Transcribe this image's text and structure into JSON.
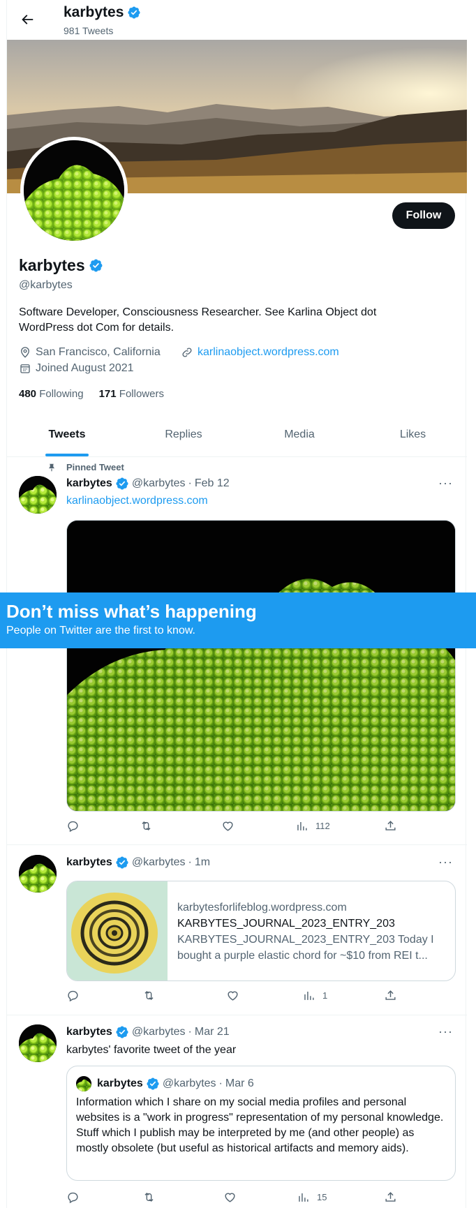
{
  "header": {
    "name": "karbytes",
    "tweet_count": "981 Tweets"
  },
  "profile": {
    "name": "karbytes",
    "handle": "@karbytes",
    "bio": "Software Developer, Consciousness Researcher. See Karlina Object dot WordPress dot Com for details.",
    "location": "San Francisco, California",
    "website": "karlinaobject.wordpress.com",
    "joined": "Joined August 2021",
    "following_count": "480",
    "following_label": "Following",
    "followers_count": "171",
    "followers_label": "Followers",
    "follow_button": "Follow"
  },
  "tabs": [
    {
      "label": "Tweets"
    },
    {
      "label": "Replies"
    },
    {
      "label": "Media"
    },
    {
      "label": "Likes"
    }
  ],
  "tweets": [
    {
      "pinned_label": "Pinned Tweet",
      "name": "karbytes",
      "handle": "@karbytes",
      "sep": "·",
      "time": "Feb 12",
      "text": "karlinaobject.wordpress.com",
      "views": "112"
    },
    {
      "name": "karbytes",
      "handle": "@karbytes",
      "sep": "·",
      "time": "1m",
      "card": {
        "domain": "karbytesforlifeblog.wordpress.com",
        "title": "KARBYTES_JOURNAL_2023_ENTRY_203",
        "description": "KARBYTES_JOURNAL_2023_ENTRY_203 Today I bought a purple elastic chord for ~$10 from REI t..."
      },
      "views": "1"
    },
    {
      "name": "karbytes",
      "handle": "@karbytes",
      "sep": "·",
      "time": "Mar 21",
      "text": "karbytes' favorite tweet of the year",
      "quote": {
        "name": "karbytes",
        "handle": "@karbytes",
        "sep": "·",
        "time": "Mar 6",
        "text": "Information which I share on my social media profiles and personal websites is a \"work in progress\" representation of my personal knowledge. Stuff which I publish may be interpreted by me (and other people) as mostly obsolete (but useful as historical artifacts and memory aids)."
      },
      "views": "15"
    }
  ],
  "signup_banner": {
    "title": "Don’t miss what’s happening",
    "subtitle": "People on Twitter are the first to know."
  },
  "more_glyph": "···",
  "colors": {
    "accent": "#1d9bf0",
    "text": "#0f1419",
    "muted": "#536471"
  }
}
